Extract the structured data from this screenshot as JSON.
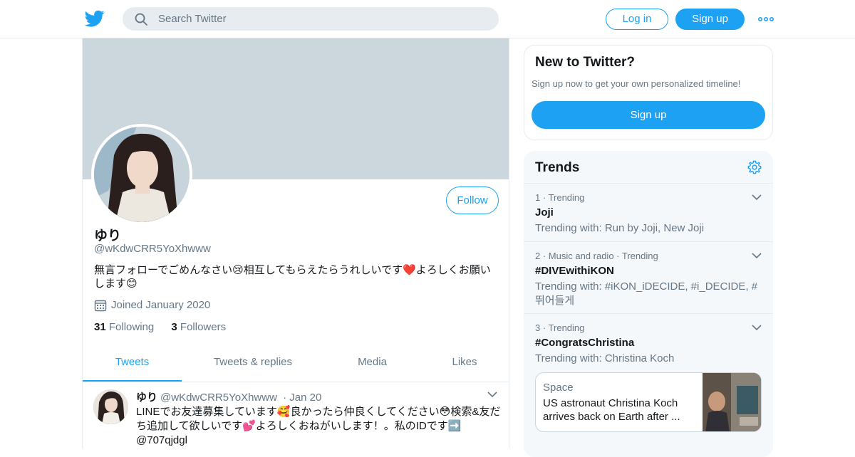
{
  "header": {
    "search_placeholder": "Search Twitter",
    "login_label": "Log in",
    "signup_label": "Sign up"
  },
  "profile": {
    "name": "ゆり",
    "handle": "@wKdwCRR5YoXhwww",
    "bio": "無言フォローでごめんなさい😢相互してもらえたらうれしいです❤️よろしくお願いします😊",
    "joined": "Joined January 2020",
    "following_count": "31",
    "following_label": "Following",
    "followers_count": "3",
    "followers_label": "Followers",
    "follow_label": "Follow"
  },
  "tabs": [
    {
      "label": "Tweets",
      "active": true
    },
    {
      "label": "Tweets & replies",
      "active": false
    },
    {
      "label": "Media",
      "active": false
    },
    {
      "label": "Likes",
      "active": false
    }
  ],
  "tweet": {
    "name": "ゆり",
    "handle": "@wKdwCRR5YoXhwww",
    "date": "· Jan 20",
    "text": "LINEでお友達募集しています🥰良かったら仲良くしてください😳検索&友だち追加して欲しいです💕よろしくおねがいします！。私のIDです➡️ @707qjdgl"
  },
  "sidebar": {
    "new_title": "New to Twitter?",
    "new_desc": "Sign up now to get your own personalized timeline!",
    "new_button": "Sign up",
    "trends_title": "Trends",
    "trends": [
      {
        "meta": "1 · Trending",
        "title": "Joji",
        "with": "Trending with: Run by Joji, New Joji"
      },
      {
        "meta": "2 · Music and radio · Trending",
        "title": "#DIVEwithiKON",
        "with": "Trending with: #iKON_iDECIDE, #i_DECIDE, #뛰어들게"
      },
      {
        "meta": "3 · Trending",
        "title": "#CongratsChristina",
        "with": "Trending with: Christina Koch"
      }
    ],
    "card": {
      "category": "Space",
      "headline": "US astronaut Christina Koch arrives back on Earth after ..."
    }
  },
  "colors": {
    "accent": "#1da1f2",
    "banner": "#ccd6dd",
    "secondary_text": "#657786",
    "trends_bg": "#f5f8fa"
  },
  "icons": [
    "twitter-bird-icon",
    "search-icon",
    "more-dots-icon",
    "calendar-icon",
    "chevron-down-icon",
    "gear-icon"
  ]
}
